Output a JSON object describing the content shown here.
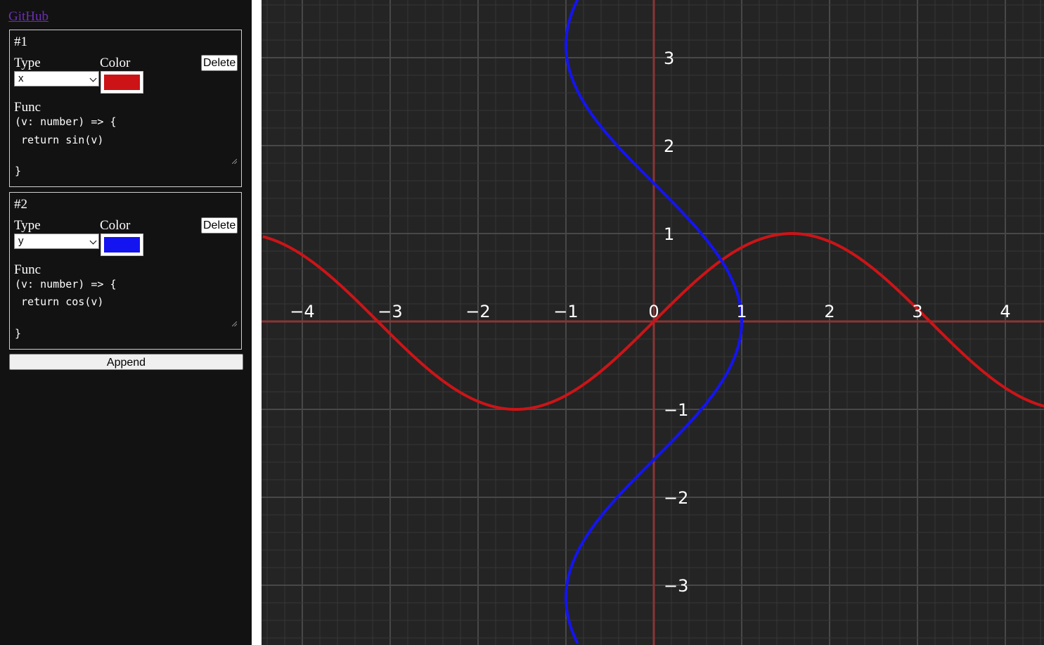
{
  "sidebar": {
    "github_link": "GitHub",
    "append_label": "Append",
    "functions": [
      {
        "title": "#1",
        "type_label": "Type",
        "type_value": "x",
        "color_label": "Color",
        "color": "#cc1417",
        "delete_label": "Delete",
        "func_label": "Func",
        "header": "(v: number) => {",
        "body": " return sin(v)",
        "footer": "}"
      },
      {
        "title": "#2",
        "type_label": "Type",
        "type_value": "y",
        "color_label": "Color",
        "color": "#1414f0",
        "delete_label": "Delete",
        "func_label": "Func",
        "header": "(v: number) => {",
        "body": " return cos(v)",
        "footer": "}"
      }
    ]
  },
  "graph": {
    "background": "#242424",
    "axis_color": "#8a3535",
    "tick_color": "#ffffff",
    "x_ticks": [
      "−4",
      "−3",
      "−2",
      "−1",
      "0",
      "1",
      "2",
      "3",
      "4"
    ],
    "y_ticks": [
      "3",
      "2",
      "1",
      "−1",
      "−2",
      "−3"
    ],
    "x_range": [
      -4.45,
      4.45
    ],
    "y_range": [
      -3.66,
      3.66
    ],
    "curves": [
      {
        "name": "#1",
        "type": "x",
        "expression": "sin(v)",
        "color": "#cc1417"
      },
      {
        "name": "#2",
        "type": "y",
        "expression": "cos(v)",
        "color": "#1414f0"
      }
    ]
  }
}
